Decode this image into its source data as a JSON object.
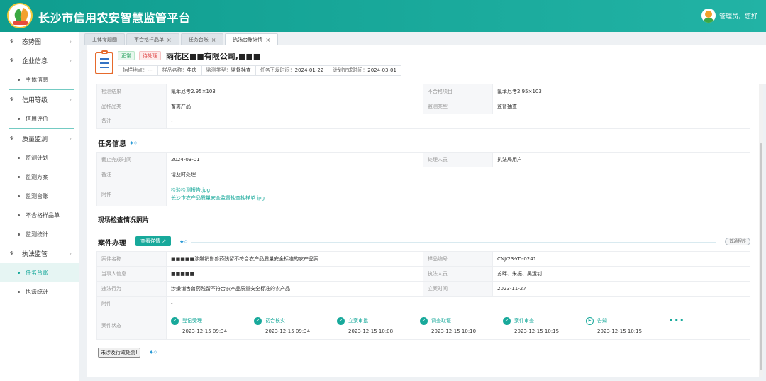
{
  "app": {
    "title": "长沙市信用农安智慧监管平台",
    "user_label": "管理员，您好"
  },
  "sidebar": {
    "groups": [
      {
        "label": "态势图",
        "icon": "menu-icon"
      },
      {
        "label": "企业信息",
        "icon": "menu-icon",
        "items": [
          "主体信息"
        ]
      },
      {
        "label": "信用等级",
        "icon": "menu-icon",
        "items": [
          "信用评价"
        ]
      },
      {
        "label": "质量监测",
        "icon": "menu-icon",
        "items": [
          "监测计划",
          "监测方案",
          "监测台账",
          "不合格样品单",
          "监测统计"
        ]
      },
      {
        "label": "执法监管",
        "icon": "menu-icon",
        "items": [
          "任务台账",
          "执法统计"
        ]
      }
    ],
    "active_item": "任务台账"
  },
  "tabs": [
    "主体专题图",
    "不合格样品单",
    "任务台账",
    "执法台账详情"
  ],
  "header": {
    "tag_normal": "正常",
    "tag_pending": "待处理",
    "company": "雨花区■■有限公司,■■■",
    "meta": [
      {
        "k": "抽样地点：",
        "v": "---"
      },
      {
        "k": "样品名称：",
        "v": "牛肉"
      },
      {
        "k": "监测类型：",
        "v": "监督抽查"
      },
      {
        "k": "任务下发时间：",
        "v": "2024-01-22"
      },
      {
        "k": "计划完成时间：",
        "v": "2024-03-01"
      }
    ]
  },
  "sample_info": {
    "rows": [
      {
        "k1": "检测结果",
        "v1": "氟苯尼考2.95×103",
        "k2": "不合格项目",
        "v2": "氟苯尼考2.95×103"
      },
      {
        "k1": "品种品类",
        "v1": "畜禽产品",
        "k2": "监测类型",
        "v2": "监督抽查"
      },
      {
        "k1": "备注",
        "v1": "-"
      }
    ]
  },
  "task_info": {
    "title": "任务信息",
    "deadline_label": "截止完成时间",
    "deadline": "2024-03-01",
    "handler_label": "处理人员",
    "handler": "执法局用户",
    "remark_label": "备注",
    "remark": "请及时处理",
    "attachment_label": "附件",
    "attachments": [
      "检验检测报告.jpg",
      "长沙市农产品质量安全监督抽查抽样单.jpg"
    ]
  },
  "site_photos": {
    "title": "现场检查情况照片"
  },
  "case": {
    "title": "案件办理",
    "detail_button": "查看详情 ↗",
    "procedure_button": "普通程序",
    "name_label": "案件名称",
    "name": "■■■■■涉嫌销售兽药残留不符合农产品质量安全标准的农产品案",
    "sample_no_label": "样品编号",
    "sample_no": "CNJ/23-YD-0241",
    "party_label": "当事人信息",
    "party": "■■■■■",
    "officers_label": "执法人员",
    "officers": "苏畔、朱振、吴运钊",
    "violation_label": "违法行为",
    "violation": "涉嫌销售兽药残留不符合农产品质量安全标准的农产品",
    "filed_label": "立案时间",
    "filed": "2023-11-27",
    "attachment_label": "附件",
    "attachment": "-",
    "status_label": "案件状态",
    "steps": [
      {
        "label": "登记受理",
        "time": "2023-12-15 09:34",
        "state": "done"
      },
      {
        "label": "初合核实",
        "time": "2023-12-15 09:34",
        "state": "done"
      },
      {
        "label": "立案审批",
        "time": "2023-12-15 10:08",
        "state": "done"
      },
      {
        "label": "调查取证",
        "time": "2023-12-15 10:10",
        "state": "done"
      },
      {
        "label": "案件审查",
        "time": "2023-12-15 10:15",
        "state": "done"
      },
      {
        "label": "告知",
        "time": "2023-12-15 10:15",
        "state": "current"
      }
    ],
    "more": "•••"
  },
  "admin_penalty_button": "未涉及行政处罚!",
  "colors": {
    "primary": "#18a99b",
    "header": "#0f9d8f",
    "danger": "#e04a4a"
  }
}
